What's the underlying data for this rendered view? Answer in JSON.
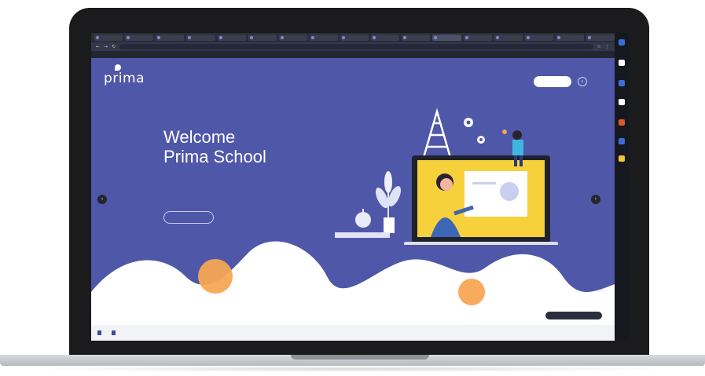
{
  "browser": {
    "tabs": [
      "",
      "",
      "",
      "",
      "",
      "",
      "",
      "",
      "",
      "",
      "",
      "",
      "",
      "",
      "",
      "",
      ""
    ],
    "url": "",
    "admin_bar": {
      "items": [
        "",
        "",
        "",
        "",
        "",
        "",
        "",
        ""
      ],
      "right": ""
    }
  },
  "site": {
    "logo": "prima",
    "menu": [
      "",
      "",
      "",
      "",
      "",
      ""
    ],
    "sign_in": "",
    "cta": "",
    "search_icon": "search-icon"
  },
  "hero": {
    "title_line1": "Welcome",
    "title_line2": "Prima School",
    "description": "",
    "button": ""
  },
  "downloads": {
    "items": [
      "",
      ""
    ],
    "show_all": ""
  },
  "whatsapp_label": "",
  "colors": {
    "hero_bg": "#4f57a8",
    "accent_orange": "#f5a654",
    "bezel": "#1b1b1d"
  }
}
